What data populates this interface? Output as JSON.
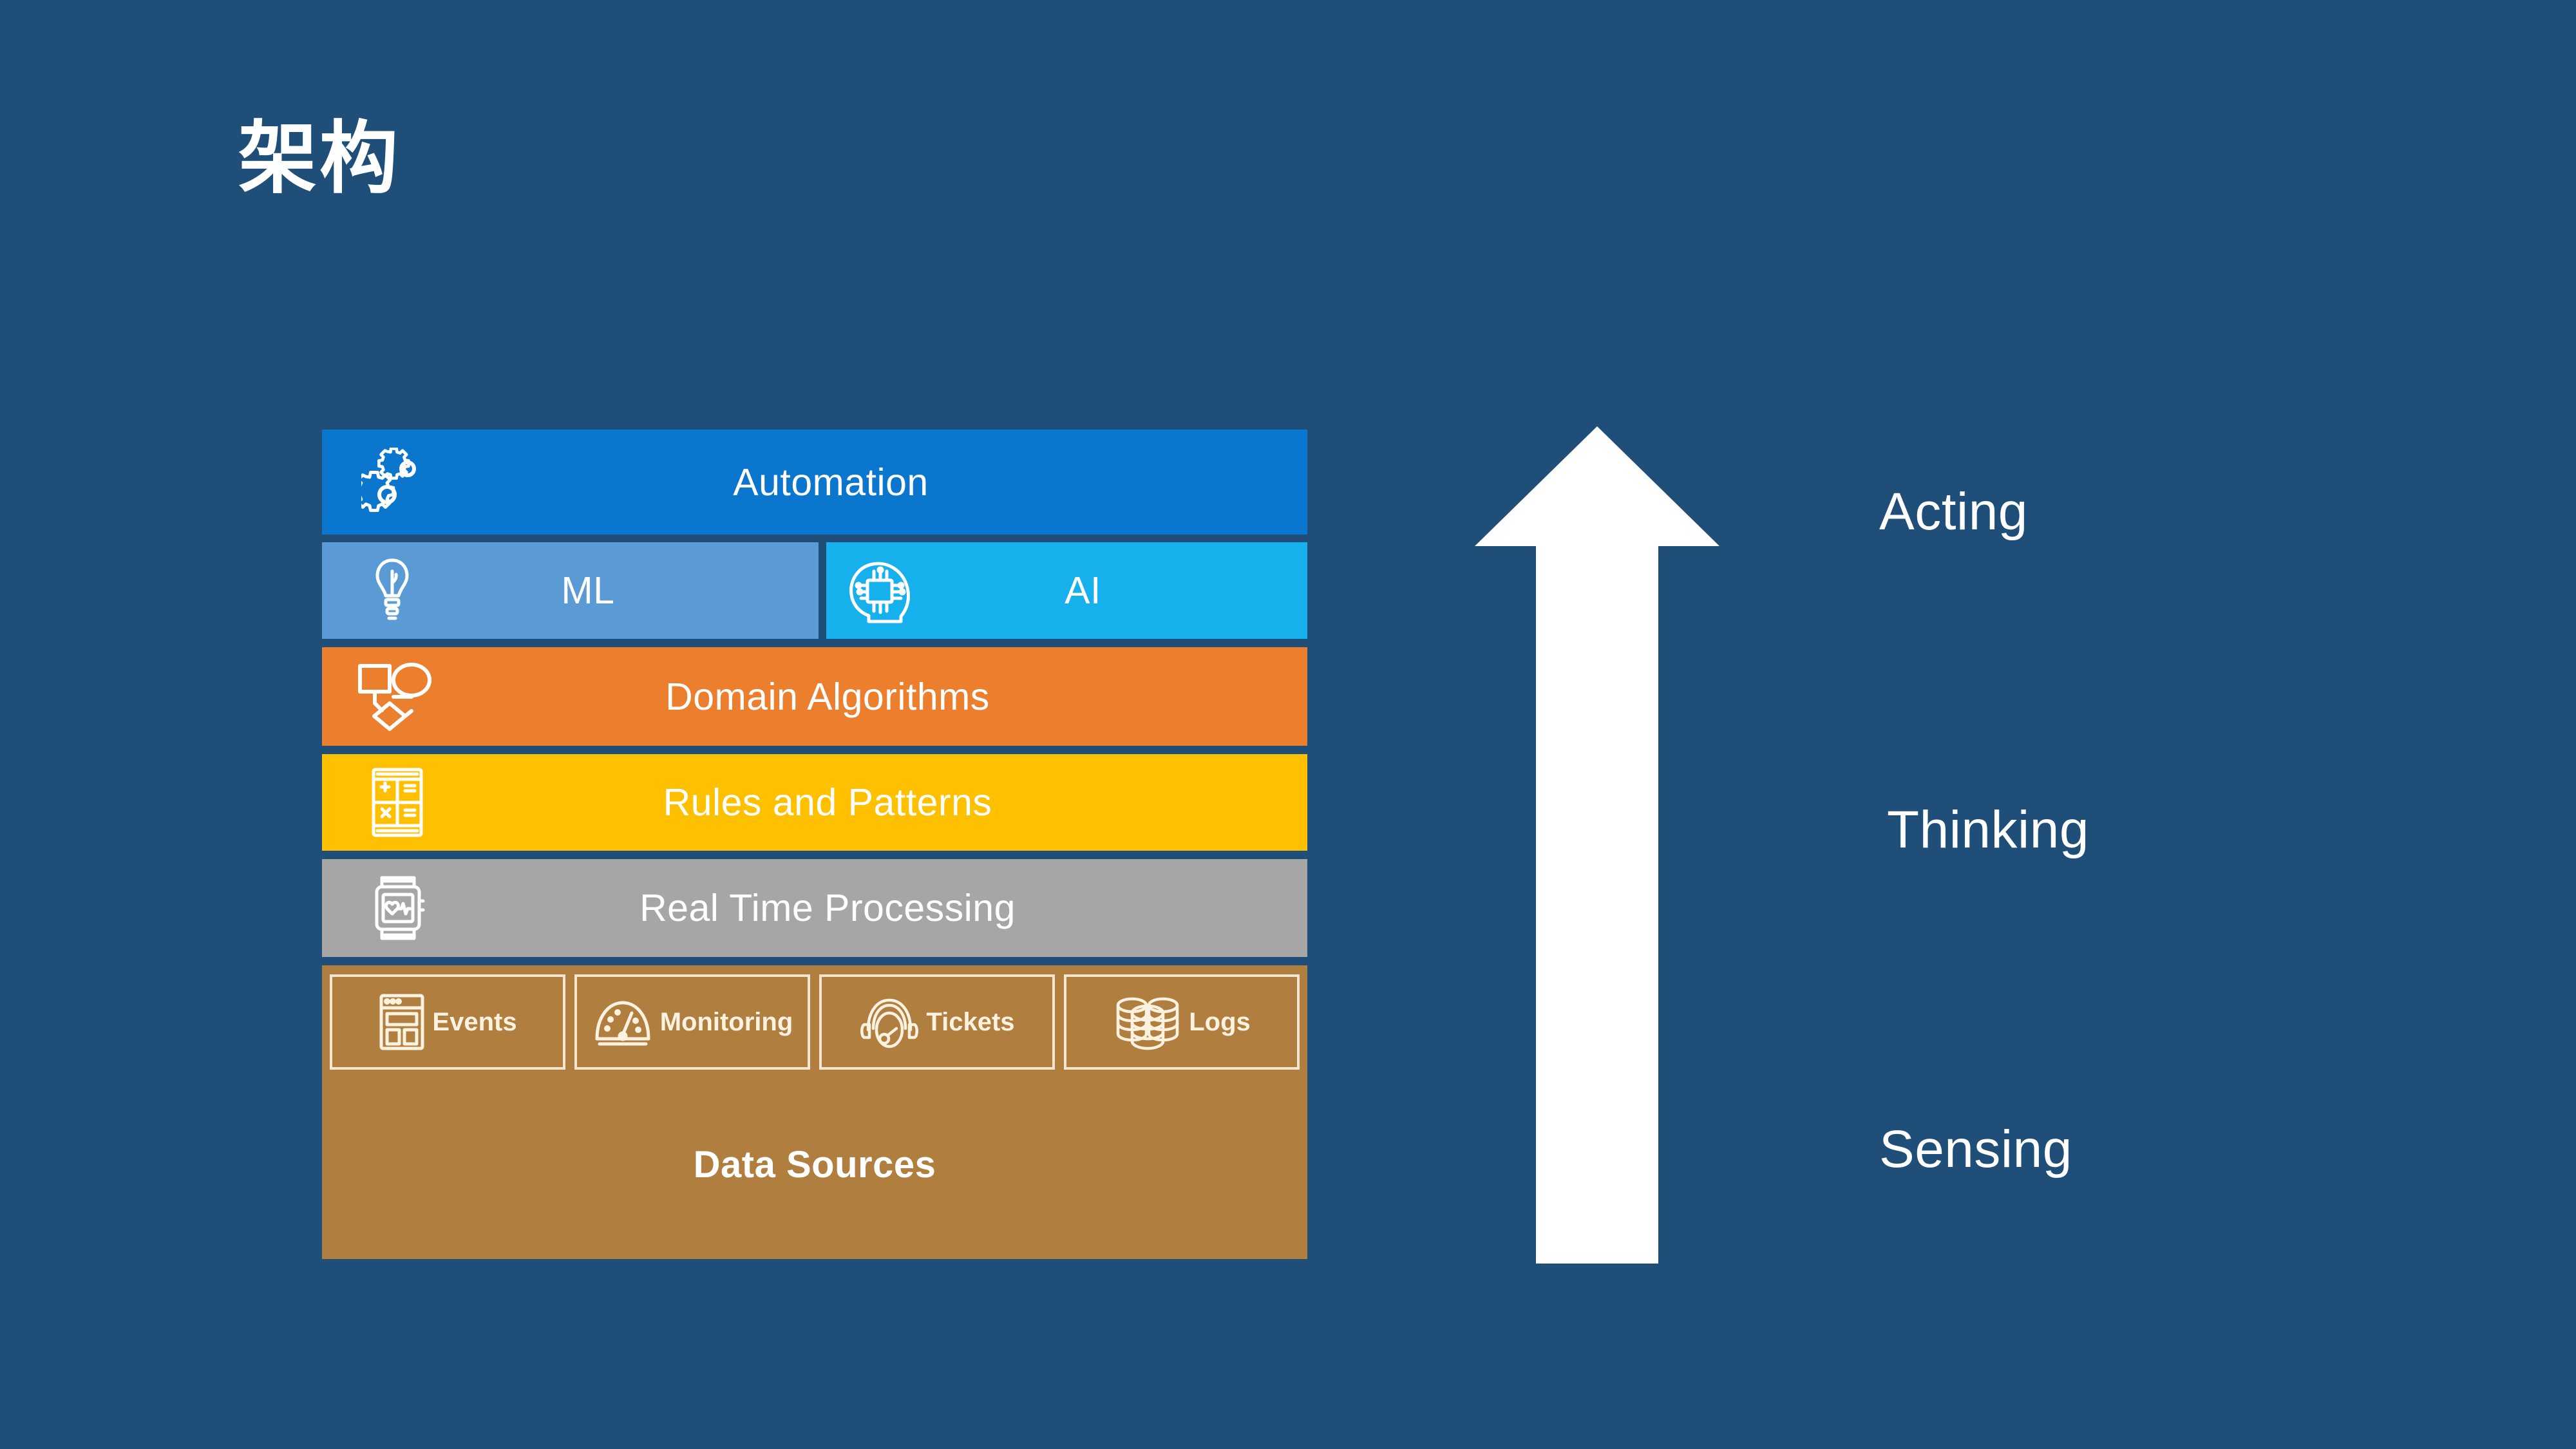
{
  "slide": {
    "title": "架构",
    "background_color": "#1f4e79"
  },
  "stack": {
    "rows": [
      {
        "id": "automation",
        "label": "Automation",
        "icon": "gears-icon",
        "color": "#0b76ce"
      },
      {
        "id": "ml",
        "label": "ML",
        "icon": "lightbulb-icon",
        "color": "#5b9bd5"
      },
      {
        "id": "ai",
        "label": "AI",
        "icon": "ai-brain-head-icon",
        "color": "#16b0ed"
      },
      {
        "id": "domain-algorithms",
        "label": "Domain Algorithms",
        "icon": "flowchart-icon",
        "color": "#ec7f2e"
      },
      {
        "id": "rules-and-patterns",
        "label": "Rules and Patterns",
        "icon": "calculator-icon",
        "color": "#ffc000"
      },
      {
        "id": "real-time-processing",
        "label": "Real Time Processing",
        "icon": "smartwatch-pulse-icon",
        "color": "#a6a6a6"
      }
    ],
    "data_sources": {
      "title": "Data Sources",
      "color": "#b07f3f",
      "border_color": "#f7e6cf",
      "items": [
        {
          "id": "events",
          "label": "Events",
          "icon": "window-layout-icon"
        },
        {
          "id": "monitoring",
          "label": "Monitoring",
          "icon": "gauge-icon"
        },
        {
          "id": "tickets",
          "label": "Tickets",
          "icon": "headset-icon"
        },
        {
          "id": "logs",
          "label": "Logs",
          "icon": "database-stack-icon"
        }
      ]
    }
  },
  "arrow": {
    "icon": "up-arrow-icon",
    "direction": "up",
    "color": "#ffffff"
  },
  "stages": [
    {
      "id": "acting",
      "label": "Acting"
    },
    {
      "id": "thinking",
      "label": "Thinking"
    },
    {
      "id": "sensing",
      "label": "Sensing"
    }
  ]
}
